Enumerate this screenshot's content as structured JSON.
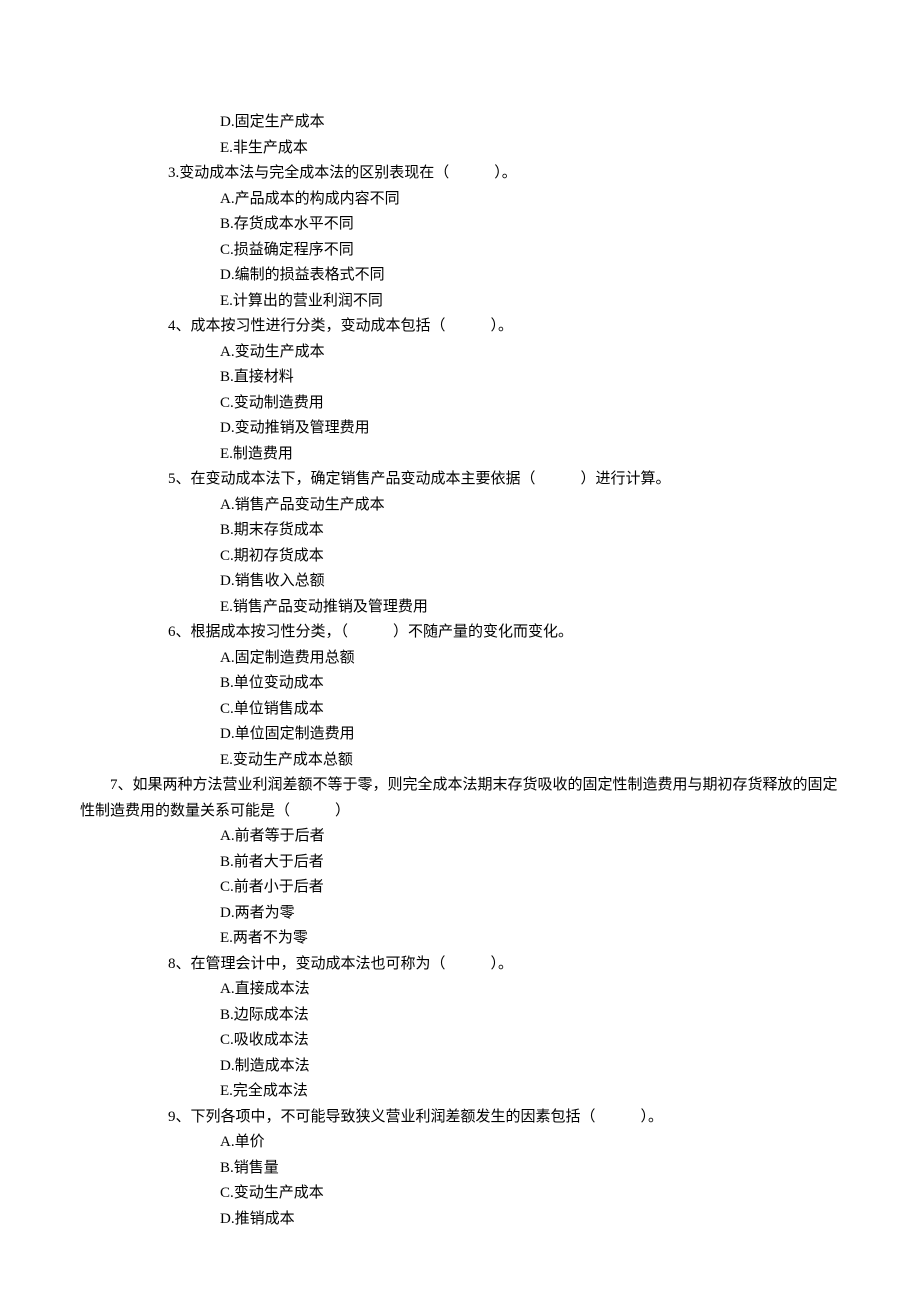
{
  "orphan_options": [
    "D.固定生产成本",
    "E.非生产成本"
  ],
  "questions": [
    {
      "stem_indent": "question",
      "stem": "3.变动成本法与完全成本法的区别表现在（　　　）。",
      "options": [
        "A.产品成本的构成内容不同",
        "B.存货成本水平不同",
        "C.损益确定程序不同",
        "D.编制的损益表格式不同",
        "E.计算出的营业利润不同"
      ]
    },
    {
      "stem_indent": "question",
      "stem": "4、成本按习性进行分类，变动成本包括（　　　）。",
      "options": [
        "A.变动生产成本",
        "B.直接材料",
        "C.变动制造费用",
        "D.变动推销及管理费用",
        "E.制造费用"
      ]
    },
    {
      "stem_indent": "question",
      "stem": "5、在变动成本法下，确定销售产品变动成本主要依据（　　　）进行计算。",
      "options": [
        "A.销售产品变动生产成本",
        "B.期末存货成本",
        "C.期初存货成本",
        "D.销售收入总额",
        "E.销售产品变动推销及管理费用"
      ]
    },
    {
      "stem_indent": "question",
      "stem": "6、根据成本按习性分类，（　　　）不随产量的变化而变化。",
      "options": [
        "A.固定制造费用总额",
        "B.单位变动成本",
        "C.单位销售成本",
        "D.单位固定制造费用",
        "E.变动生产成本总额"
      ]
    },
    {
      "stem_indent": "question-wrap",
      "stem": "　　7、如果两种方法营业利润差额不等于零，则完全成本法期末存货吸收的固定性制造费用与期初存货释放的固定性制造费用的数量关系可能是（　　　）",
      "options": [
        "A.前者等于后者",
        "B.前者大于后者",
        "C.前者小于后者",
        "D.两者为零",
        "E.两者不为零"
      ]
    },
    {
      "stem_indent": "question",
      "stem": "8、在管理会计中，变动成本法也可称为（　　　）。",
      "options": [
        "A.直接成本法",
        "B.边际成本法",
        "C.吸收成本法",
        "D.制造成本法",
        "E.完全成本法"
      ]
    },
    {
      "stem_indent": "question",
      "stem": "9、下列各项中，不可能导致狭义营业利润差额发生的因素包括（　　　）。",
      "options": [
        "A.单价",
        "B.销售量",
        "C.变动生产成本",
        "D.推销成本"
      ]
    }
  ]
}
